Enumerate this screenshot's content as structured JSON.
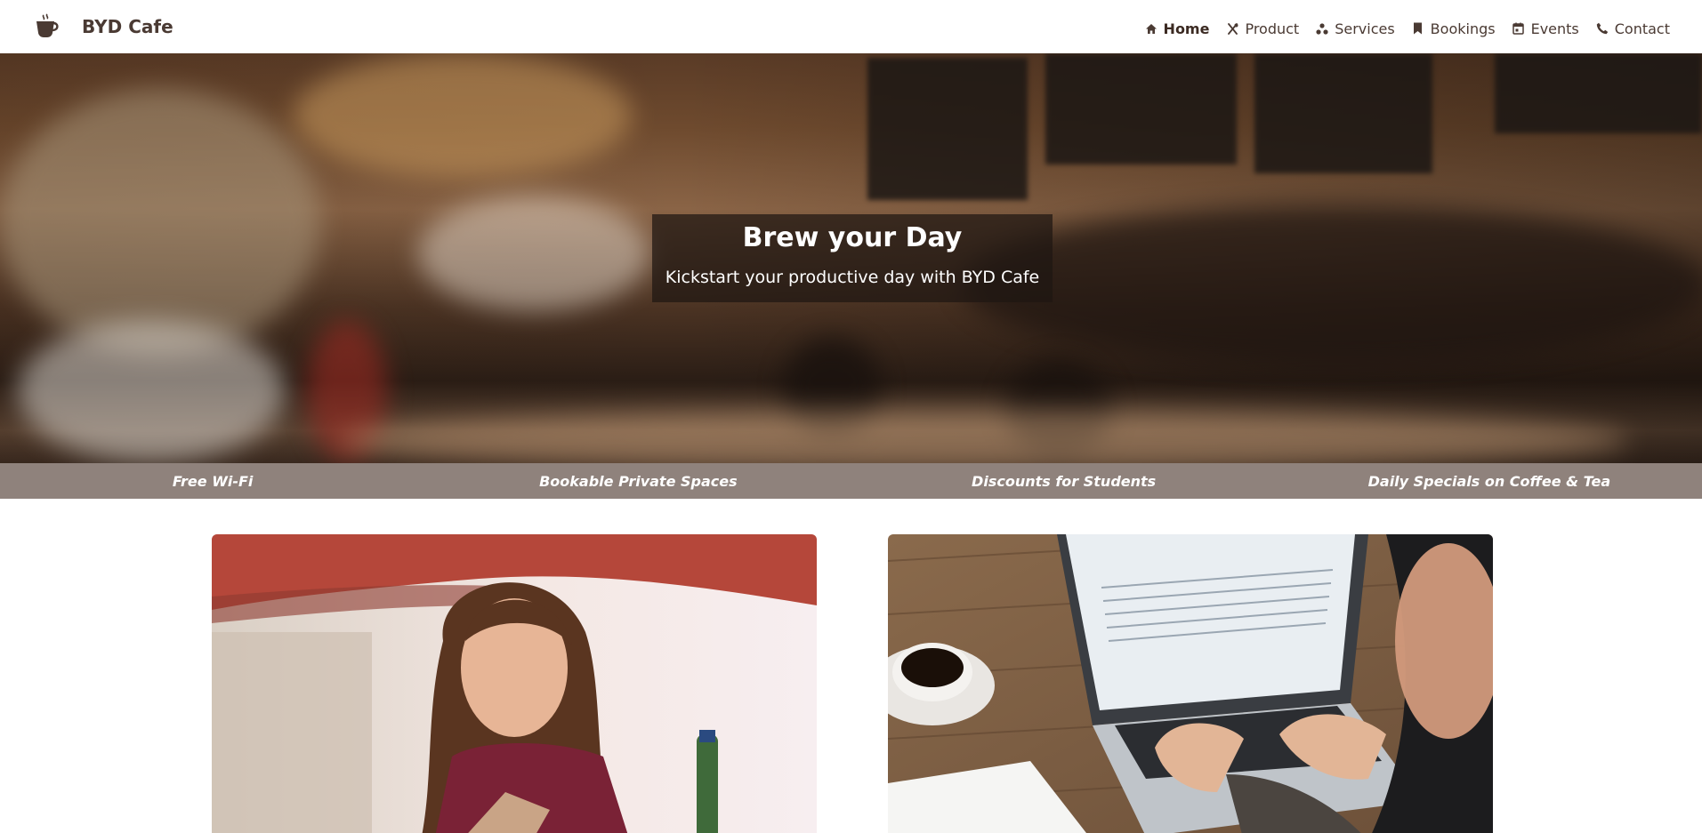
{
  "brand": {
    "name": "BYD Cafe",
    "icon": "coffee-cup-icon"
  },
  "nav": {
    "items": [
      {
        "label": "Home",
        "icon": "home-icon",
        "active": true
      },
      {
        "label": "Product",
        "icon": "utensils-icon",
        "active": false
      },
      {
        "label": "Services",
        "icon": "services-icon",
        "active": false
      },
      {
        "label": "Bookings",
        "icon": "bookmark-icon",
        "active": false
      },
      {
        "label": "Events",
        "icon": "calendar-icon",
        "active": false
      },
      {
        "label": "Contact",
        "icon": "phone-icon",
        "active": false
      }
    ]
  },
  "hero": {
    "title": "Brew your Day",
    "subtitle": "Kickstart your productive day with BYD Cafe"
  },
  "features": [
    "Free Wi-Fi",
    "Bookable Private Spaces",
    "Discounts for Students",
    "Daily Specials on Coffee & Tea"
  ],
  "cards": [
    {
      "image": "woman-with-tablet-photo"
    },
    {
      "image": "laptop-and-coffee-photo"
    }
  ],
  "colors": {
    "brand_text": "#4a3a33",
    "features_bg": "#8f827c",
    "hero_overlay": "#1e1612"
  }
}
